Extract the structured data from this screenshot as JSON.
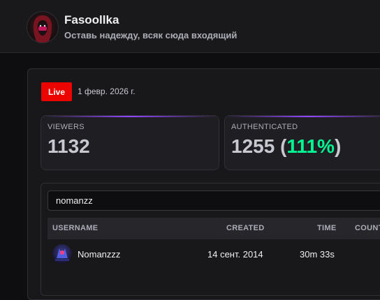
{
  "channel": {
    "name": "Fasoollka",
    "subtitle": "Оставь надежду, всяк сюда входящий"
  },
  "stream": {
    "live_label": "Live",
    "date": "1 февр. 2026 г."
  },
  "stats": {
    "viewers_label": "VIEWERS",
    "viewers_value": "1132",
    "auth_label": "AUTHENTICATED",
    "auth_value": "1255",
    "auth_open": " (",
    "auth_percent": "111%",
    "auth_close": ")"
  },
  "search": {
    "value": "nomanzz"
  },
  "table": {
    "columns": [
      "USERNAME",
      "CREATED",
      "TIME",
      "COUNT"
    ],
    "rows": [
      {
        "username": "Nomanzzz",
        "created": "14 сент. 2014",
        "time": "30m 33s"
      }
    ]
  },
  "colors": {
    "live": "#eb0400",
    "accent": "#9147ff",
    "percent": "#00f593"
  }
}
